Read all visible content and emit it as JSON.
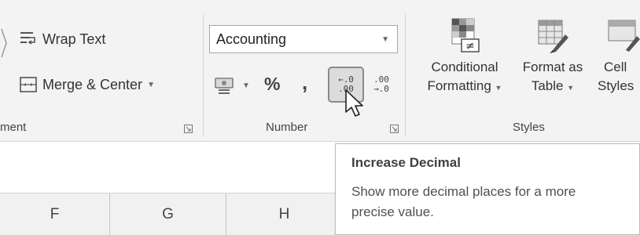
{
  "alignment": {
    "group_label": "ment",
    "wrap_text_label": "Wrap Text",
    "merge_center_label": "Merge & Center"
  },
  "number": {
    "group_label": "Number",
    "format_value": "Accounting",
    "percent_label": "%",
    "comma_label": ",",
    "increase_decimal_top": "←.0",
    "increase_decimal_bottom": ".00",
    "decrease_decimal_top": ".00",
    "decrease_decimal_bottom": "→.0"
  },
  "styles": {
    "group_label": "Styles",
    "conditional_line1": "Conditional",
    "conditional_line2": "Formatting",
    "format_table_line1": "Format as",
    "format_table_line2": "Table",
    "cell_styles_line1": "Cell",
    "cell_styles_line2": "Styles"
  },
  "columns": [
    "F",
    "G",
    "H"
  ],
  "tooltip": {
    "title": "Increase Decimal",
    "description": "Show more decimal places for a more precise value."
  },
  "colors": {
    "ribbon_bg": "#f3f3f3",
    "hover_border": "#8a8a8a",
    "hover_bg": "#dcdcdc"
  }
}
